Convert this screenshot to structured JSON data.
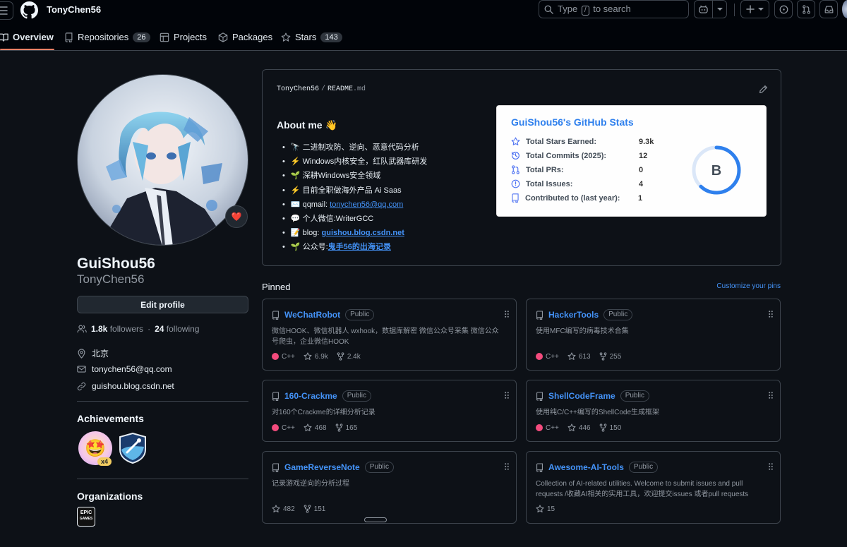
{
  "header": {
    "username": "TonyChen56",
    "search": {
      "prefix": "Type",
      "key": "/",
      "suffix": "to search"
    }
  },
  "tabs": [
    {
      "label": "Overview",
      "icon": "book-icon",
      "active": true
    },
    {
      "label": "Repositories",
      "count": "26",
      "icon": "repo-icon"
    },
    {
      "label": "Projects",
      "icon": "table-icon"
    },
    {
      "label": "Packages",
      "icon": "package-icon"
    },
    {
      "label": "Stars",
      "count": "143",
      "icon": "star-icon"
    }
  ],
  "profile": {
    "name": "GuiShou56",
    "login": "TonyChen56",
    "status_emoji": "❤️",
    "edit_label": "Edit profile",
    "followers": "1.8k",
    "followers_label": "followers",
    "dot": "·",
    "following": "24",
    "following_label": "following",
    "location": "北京",
    "email": "tonychen56@qq.com",
    "website": "guishou.blog.csdn.net",
    "achievements_title": "Achievements",
    "achievement_count": "x4",
    "organizations_title": "Organizations",
    "org_logo_text": "EPIC GAMES"
  },
  "readme": {
    "path_user": "TonyChen56",
    "path_sep": "/",
    "path_file": "README",
    "path_ext": ".md",
    "about_title": "About me 👋",
    "items": [
      {
        "text": "🔭 二进制攻防、逆向、恶意代码分析"
      },
      {
        "text": "⚡ Windows内核安全，红队武器库研发"
      },
      {
        "text": "🌱 深耕Windows安全领域"
      },
      {
        "text": "⚡ 目前全职做海外产品 Ai Saas"
      },
      {
        "text": "✉️ qqmail: ",
        "link": "tonychen56@qq.com"
      },
      {
        "text": "💬 个人微信:WriterGCC"
      },
      {
        "text": "📝 blog: ",
        "link": "guishou.blog.csdn.net"
      },
      {
        "text": "🌱 公众号:",
        "link": "鬼手56的出海记录"
      }
    ],
    "stats": {
      "title": "GuiShou56's GitHub Stats",
      "grade": "B",
      "grade_progress": 0.62,
      "colors": {
        "title": "#2f80ed",
        "ring": "#2f80ed",
        "icon": "#4c71f2"
      },
      "rows": [
        {
          "label": "Total Stars Earned:",
          "value": "9.3k",
          "icon": "star-icon"
        },
        {
          "label": "Total Commits (2025):",
          "value": "12",
          "icon": "history-icon"
        },
        {
          "label": "Total PRs:",
          "value": "0",
          "icon": "pull-request-icon"
        },
        {
          "label": "Total Issues:",
          "value": "4",
          "icon": "issue-icon"
        },
        {
          "label": "Contributed to (last year):",
          "value": "1",
          "icon": "repo-icon"
        }
      ]
    }
  },
  "pinned": {
    "title": "Pinned",
    "customize": "Customize your pins",
    "public_label": "Public",
    "lang_color": "#f34b7d",
    "repos": [
      {
        "name": "WeChatRobot",
        "desc": "微信HOOK、微信机器人 wxhook，数据库解密 微信公众号采集 微信公众号爬虫，企业微信HOOK",
        "lang": "C++",
        "stars": "6.9k",
        "forks": "2.4k"
      },
      {
        "name": "HackerTools",
        "desc": "使用MFC编写的病毒技术合集",
        "lang": "C++",
        "stars": "613",
        "forks": "255"
      },
      {
        "name": "160-Crackme",
        "desc": "对160个Crackme的详细分析记录",
        "lang": "C++",
        "stars": "468",
        "forks": "165"
      },
      {
        "name": "ShellCodeFrame",
        "desc": "使用纯C/C++编写的ShellCode生成框架",
        "lang": "C++",
        "stars": "446",
        "forks": "150"
      },
      {
        "name": "GameReverseNote",
        "desc": "记录游戏逆向的分析过程",
        "lang": "",
        "stars": "482",
        "forks": "151"
      },
      {
        "name": "Awesome-AI-Tools",
        "desc": "Collection of AI-related utilities. Welcome to submit issues and pull requests /收藏AI相关的实用工具，欢迎提交issues 或者pull requests",
        "lang": "",
        "stars": "15",
        "forks": ""
      }
    ]
  }
}
